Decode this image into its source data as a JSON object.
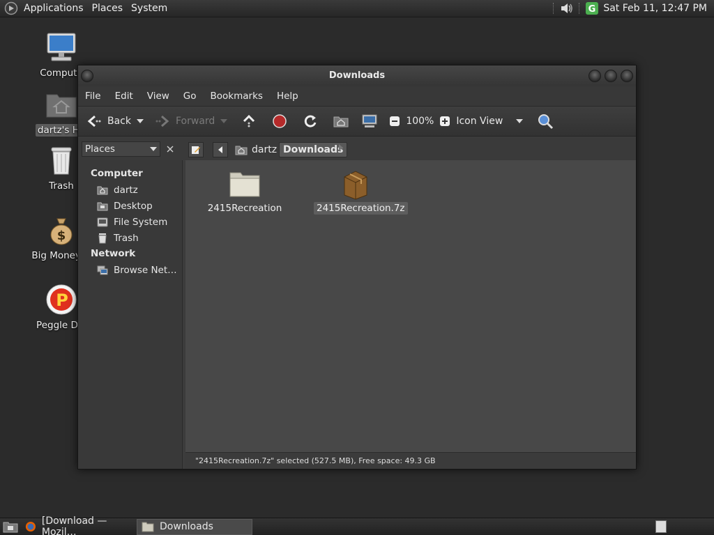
{
  "top_panel": {
    "menus": [
      "Applications",
      "Places",
      "System"
    ],
    "clock": "Sat Feb 11, 12:47 PM",
    "icons": [
      "app-logo-icon",
      "volume-icon",
      "update-notifier-icon"
    ]
  },
  "desktop": {
    "icons": [
      {
        "label": "Compute",
        "icon": "computer-icon"
      },
      {
        "label": "dartz's Ho",
        "icon": "home-folder-icon"
      },
      {
        "label": "Trash",
        "icon": "trash-icon"
      },
      {
        "label": "Big Money D",
        "icon": "money-bag-icon"
      },
      {
        "label": "Peggle Del",
        "icon": "peggle-icon"
      }
    ]
  },
  "window": {
    "title": "Downloads",
    "menu": [
      "File",
      "Edit",
      "View",
      "Go",
      "Bookmarks",
      "Help"
    ],
    "toolbar": {
      "back": "Back",
      "forward": "Forward",
      "zoom": "100%",
      "view_mode": "Icon View"
    },
    "location": {
      "side_pane": "Places",
      "crumbs": [
        "dartz",
        "Downloads"
      ]
    },
    "sidebar": {
      "sections": [
        {
          "title": "Computer",
          "items": [
            {
              "label": "dartz",
              "icon": "home-icon"
            },
            {
              "label": "Desktop",
              "icon": "desktop-icon"
            },
            {
              "label": "File System",
              "icon": "drive-icon"
            },
            {
              "label": "Trash",
              "icon": "trash-icon"
            }
          ]
        },
        {
          "title": "Network",
          "items": [
            {
              "label": "Browse Net…",
              "icon": "network-icon"
            }
          ]
        }
      ]
    },
    "files": [
      {
        "name": "2415Recreation",
        "type": "folder",
        "selected": false
      },
      {
        "name": "2415Recreation.7z",
        "type": "archive",
        "selected": true
      }
    ],
    "status": "\"2415Recreation.7z\" selected (527.5 MB), Free space: 49.3 GB"
  },
  "bottom_panel": {
    "tasks": [
      {
        "label": "[Download — Mozil…",
        "icon": "firefox-icon",
        "active": false
      },
      {
        "label": "Downloads",
        "icon": "folder-icon",
        "active": true
      }
    ]
  }
}
